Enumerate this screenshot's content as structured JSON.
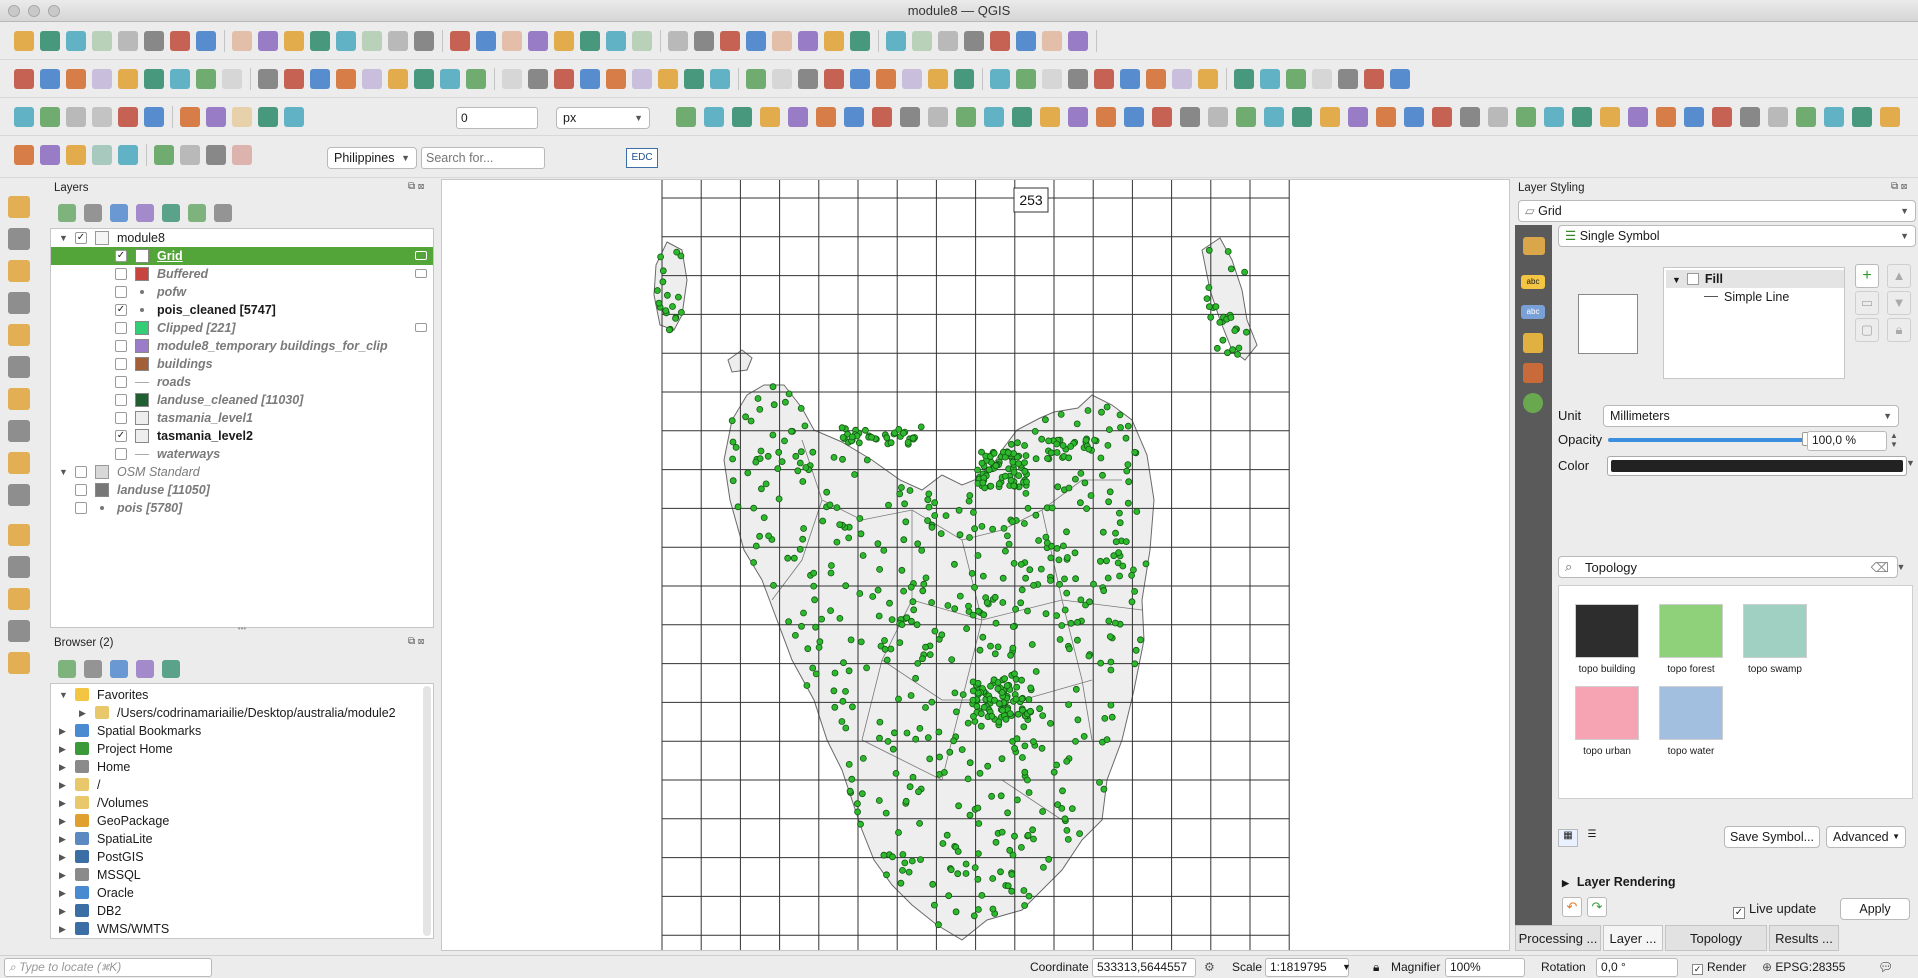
{
  "window": {
    "title": "module8 — QGIS"
  },
  "toolbar4": {
    "offset_value": "0",
    "unit": "px",
    "locator_country": "Philippines",
    "search_placeholder": "Search for...",
    "edc_label": "EDC"
  },
  "layers_panel": {
    "title": "Layers",
    "items": [
      {
        "label": "module8",
        "style": "normal",
        "checked": true,
        "kind": "group"
      },
      {
        "label": "Grid",
        "style": "bold-underline",
        "checked": true,
        "swatch": "#ffffff",
        "selected": true
      },
      {
        "label": "Buffered",
        "style": "italic",
        "checked": false,
        "swatch": "#c8453f"
      },
      {
        "label": "pofw",
        "style": "italic",
        "checked": false,
        "swatch": "dot"
      },
      {
        "label": "pois_cleaned [5747]",
        "style": "bold",
        "checked": true,
        "swatch": "dot"
      },
      {
        "label": "Clipped [221]",
        "style": "italic",
        "checked": false,
        "swatch": "#33cc77"
      },
      {
        "label": "module8_temporary buildings_for_clip",
        "style": "italic",
        "checked": false,
        "swatch": "#9a7cc9"
      },
      {
        "label": "buildings",
        "style": "italic",
        "checked": false,
        "swatch": "#a35f37"
      },
      {
        "label": "roads",
        "style": "italic",
        "checked": false,
        "swatch": "line"
      },
      {
        "label": "landuse_cleaned [11030]",
        "style": "italic",
        "checked": false,
        "swatch": "#1f5f32"
      },
      {
        "label": "tasmania_level1",
        "style": "italic",
        "checked": false,
        "swatch": "#eeeeee"
      },
      {
        "label": "tasmania_level2",
        "style": "bold",
        "checked": true,
        "swatch": "#eeeeee"
      },
      {
        "label": "waterways",
        "style": "italic",
        "checked": false,
        "swatch": "line"
      },
      {
        "label": "OSM Standard",
        "style": "italic",
        "checked": false,
        "kind": "group"
      },
      {
        "label": "landuse [11050]",
        "style": "italic",
        "checked": false,
        "swatch": "#777777"
      },
      {
        "label": "pois [5780]",
        "style": "italic",
        "checked": false,
        "swatch": "dot"
      }
    ]
  },
  "browser_panel": {
    "title": "Browser (2)",
    "items": [
      {
        "label": "Favorites"
      },
      {
        "label": "/Users/codrinamariailie/Desktop/australia/module2"
      },
      {
        "label": "Spatial Bookmarks"
      },
      {
        "label": "Project Home"
      },
      {
        "label": "Home"
      },
      {
        "label": "/"
      },
      {
        "label": "/Volumes"
      },
      {
        "label": "GeoPackage"
      },
      {
        "label": "SpatiaLite"
      },
      {
        "label": "PostGIS"
      },
      {
        "label": "MSSQL"
      },
      {
        "label": "Oracle"
      },
      {
        "label": "DB2"
      },
      {
        "label": "WMS/WMTS"
      }
    ]
  },
  "map": {
    "feature_label": "253"
  },
  "styling_panel": {
    "title": "Layer Styling",
    "layer": "Grid",
    "renderer": "Single Symbol",
    "symbol_tree": {
      "fill": "Fill",
      "line": "Simple Line"
    },
    "unit_label": "Unit",
    "unit_value": "Millimeters",
    "opacity_label": "Opacity",
    "opacity_value": "100,0 %",
    "color_label": "Color",
    "color_value": "#222222",
    "search_value": "Topology",
    "library": [
      {
        "label": "topo building",
        "color": "#2d2d2d"
      },
      {
        "label": "topo forest",
        "color": "#8fd07a"
      },
      {
        "label": "topo swamp",
        "color": "#9fd0c2"
      },
      {
        "label": "topo urban",
        "color": "#f6a3b4"
      },
      {
        "label": "topo water",
        "color": "#a3bfe0"
      }
    ],
    "save_symbol": "Save Symbol...",
    "advanced": "Advanced",
    "layer_rendering": "Layer Rendering",
    "live_update": "Live update",
    "apply": "Apply"
  },
  "bottom_tabs": [
    "Processing ...",
    "Layer ...",
    "Topology Checke...",
    "Results ..."
  ],
  "status": {
    "locate_placeholder": "Type to locate (⌘K)",
    "coordinate_label": "Coordinate",
    "coordinate": "533313,5644557",
    "scale_label": "Scale",
    "scale": "1:1819795",
    "magnifier_label": "Magnifier",
    "magnifier": "100%",
    "rotation_label": "Rotation",
    "rotation": "0,0 °",
    "render_label": "Render",
    "crs": "EPSG:28355"
  },
  "colors": {
    "accent": "#54a539",
    "point": "#2db82d"
  }
}
